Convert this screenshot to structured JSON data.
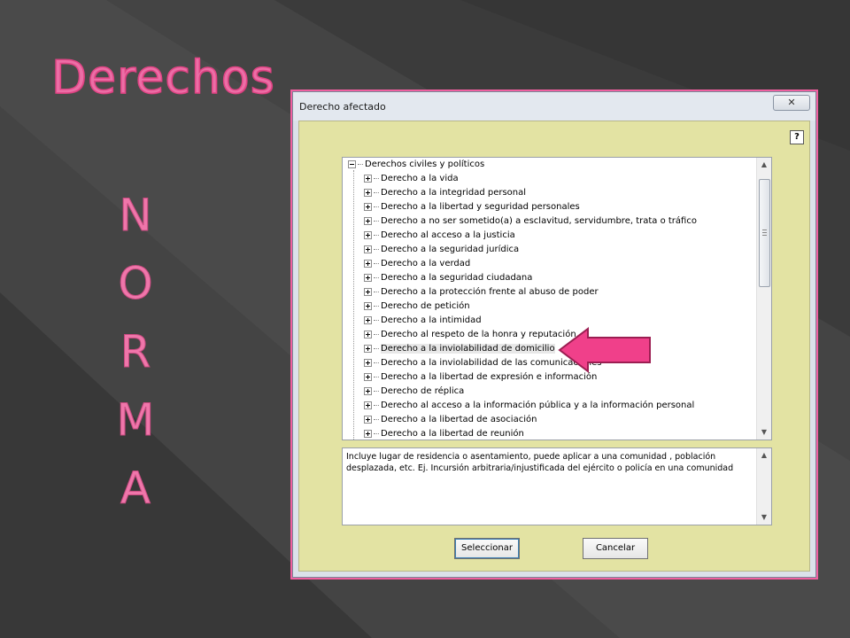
{
  "slide": {
    "title": "Derechos",
    "vertical_word": [
      "N",
      "O",
      "R",
      "M",
      "A"
    ]
  },
  "dialog": {
    "title": "Derecho afectado",
    "close_glyph": "✕",
    "help_label": "?",
    "tree": {
      "root": "Derechos civiles y políticos",
      "items": [
        "Derecho a la vida",
        "Derecho a la integridad personal",
        "Derecho a la libertad y seguridad personales",
        "Derecho a no ser sometido(a) a esclavitud,  servidumbre, trata o tráfico",
        "Derecho al acceso a la justicia",
        "Derecho a la seguridad jurídica",
        "Derecho a la verdad",
        "Derecho a la seguridad ciudadana",
        "Derecho a la protección frente al abuso de poder",
        "Derecho de petición",
        "Derecho a la intimidad",
        "Derecho al respeto de la honra y reputación",
        "Derecho a la inviolabilidad de domicilio",
        "Derecho a la inviolabilidad de las comunicaciones",
        "Derecho a la libertad de expresión e información",
        "Derecho de réplica",
        "Derecho al acceso a la información pública y a la información personal",
        "Derecho a la libertad de asociación",
        "Derecho a la libertad de reunión"
      ],
      "selected_index": 12
    },
    "description": "Incluye lugar de residencia o asentamiento, puede aplicar a una comunidad , población desplazada, etc.  Ej. Incursión arbitraria/injustificada del ejército o policía en una comunidad",
    "buttons": {
      "select_label": "Seleccionar",
      "cancel_label": "Cancelar"
    }
  },
  "colors": {
    "accent_pink": "#ec6ea6",
    "dialog_client": "#e3e3a3",
    "background": "#3d3d3d"
  }
}
